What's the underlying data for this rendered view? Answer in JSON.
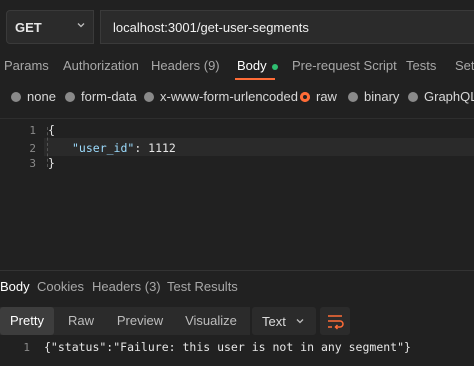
{
  "request": {
    "method": "GET",
    "url": "localhost:3001/get-user-segments"
  },
  "tabs": [
    {
      "label": "Params"
    },
    {
      "label": "Authorization"
    },
    {
      "label": "Headers (9)"
    },
    {
      "label": "Body"
    },
    {
      "label": "Pre-request Script"
    },
    {
      "label": "Tests"
    },
    {
      "label": "Sett"
    }
  ],
  "body_types": [
    {
      "label": "none"
    },
    {
      "label": "form-data"
    },
    {
      "label": "x-www-form-urlencoded"
    },
    {
      "label": "raw"
    },
    {
      "label": "binary"
    },
    {
      "label": "GraphQL"
    }
  ],
  "editor": {
    "line_numbers": [
      "1",
      "2",
      "3"
    ],
    "line1": "{",
    "line2_key": "\"user_id\"",
    "line2_rest": ": 1112",
    "line3": "}"
  },
  "response_tabs": [
    {
      "label": "Body"
    },
    {
      "label": "Cookies"
    },
    {
      "label": "Headers (3)"
    },
    {
      "label": "Test Results"
    }
  ],
  "view_modes": [
    {
      "label": "Pretty"
    },
    {
      "label": "Raw"
    },
    {
      "label": "Preview"
    },
    {
      "label": "Visualize"
    }
  ],
  "format_select": "Text",
  "response": {
    "line_number": "1",
    "text": "{\"status\":\"Failure: this user is not in any segment\"}"
  },
  "colors": {
    "accent": "#ff6c37",
    "status_dot": "#2fbf71",
    "background": "#212121"
  }
}
